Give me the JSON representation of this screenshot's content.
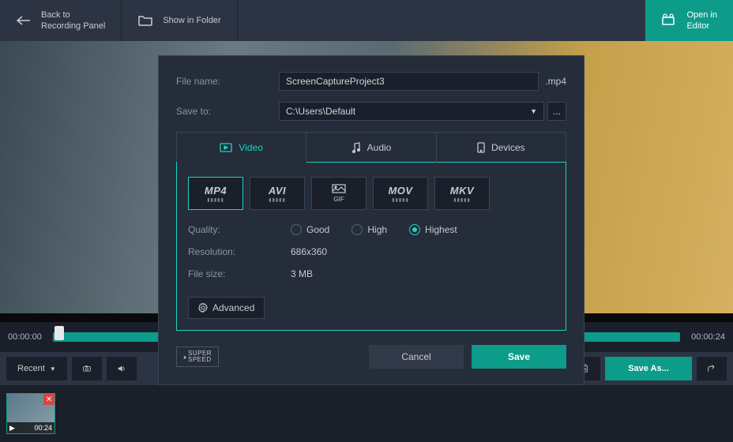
{
  "topbar": {
    "back": "Back to\nRecording Panel",
    "folder": "Show in Folder",
    "editor": "Open in\nEditor"
  },
  "timeline": {
    "start": "00:00:00",
    "end": "00:00:24"
  },
  "bottombar": {
    "recent": "Recent",
    "saveas": "Save As..."
  },
  "thumb": {
    "dur": "00:24"
  },
  "dialog": {
    "filename_label": "File name:",
    "filename_value": "ScreenCaptureProject3",
    "filename_ext": ".mp4",
    "saveto_label": "Save to:",
    "saveto_value": "C:\\Users\\Default",
    "tabs": {
      "video": "Video",
      "audio": "Audio",
      "devices": "Devices"
    },
    "formats": [
      "MP4",
      "AVI",
      "GIF",
      "MOV",
      "MKV"
    ],
    "quality_label": "Quality:",
    "quality": {
      "good": "Good",
      "high": "High",
      "highest": "Highest"
    },
    "resolution_label": "Resolution:",
    "resolution_value": "686x360",
    "filesize_label": "File size:",
    "filesize_value": "3 MB",
    "advanced": "Advanced",
    "superspeed": "SUPER\nSPEED",
    "cancel": "Cancel",
    "save": "Save"
  }
}
